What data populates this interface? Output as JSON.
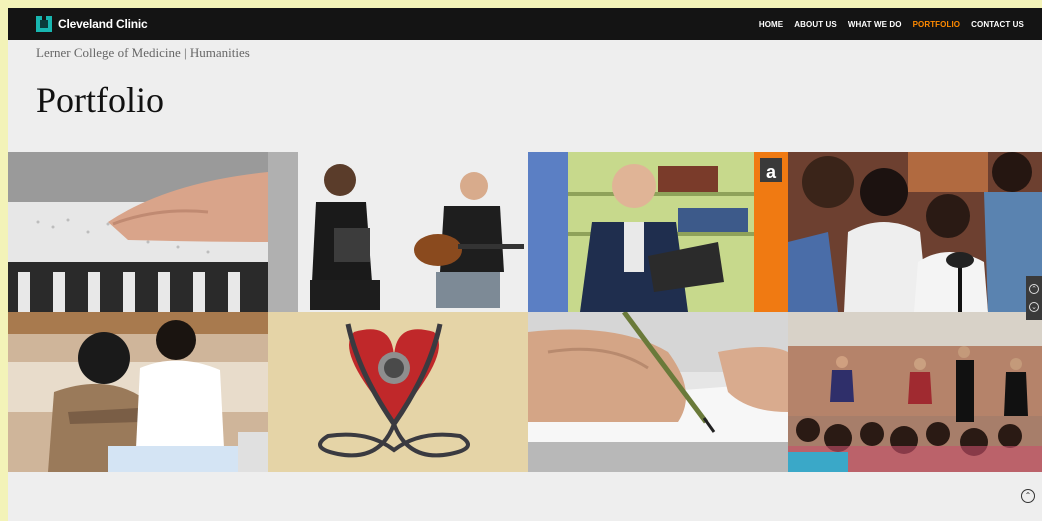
{
  "brand": {
    "name": "Cleveland Clinic",
    "logo_color": "#18b6b0"
  },
  "nav": {
    "items": [
      {
        "label": "HOME"
      },
      {
        "label": "ABOUT US"
      },
      {
        "label": "WHAT WE DO"
      },
      {
        "label": "PORTFOLIO",
        "active": true
      },
      {
        "label": "CONTACT US"
      }
    ],
    "active_color": "#ff8a00"
  },
  "header": {
    "subtitle": "Lerner College of Medicine | Humanities",
    "title": "Portfolio"
  },
  "portfolio": {
    "tiles": [
      {
        "icon": "braille-hand-photo"
      },
      {
        "icon": "musicians-photo"
      },
      {
        "icon": "reading-man-photo",
        "badge": "a"
      },
      {
        "icon": "children-singing-photo"
      },
      {
        "icon": "students-drawing-photo"
      },
      {
        "icon": "heart-stethoscope-illustration"
      },
      {
        "icon": "writing-hand-photo"
      },
      {
        "icon": "classroom-performance-photo"
      }
    ]
  },
  "controls": {
    "side_up": "⌃",
    "side_down": "⌄",
    "scroll_top": "⌃"
  }
}
